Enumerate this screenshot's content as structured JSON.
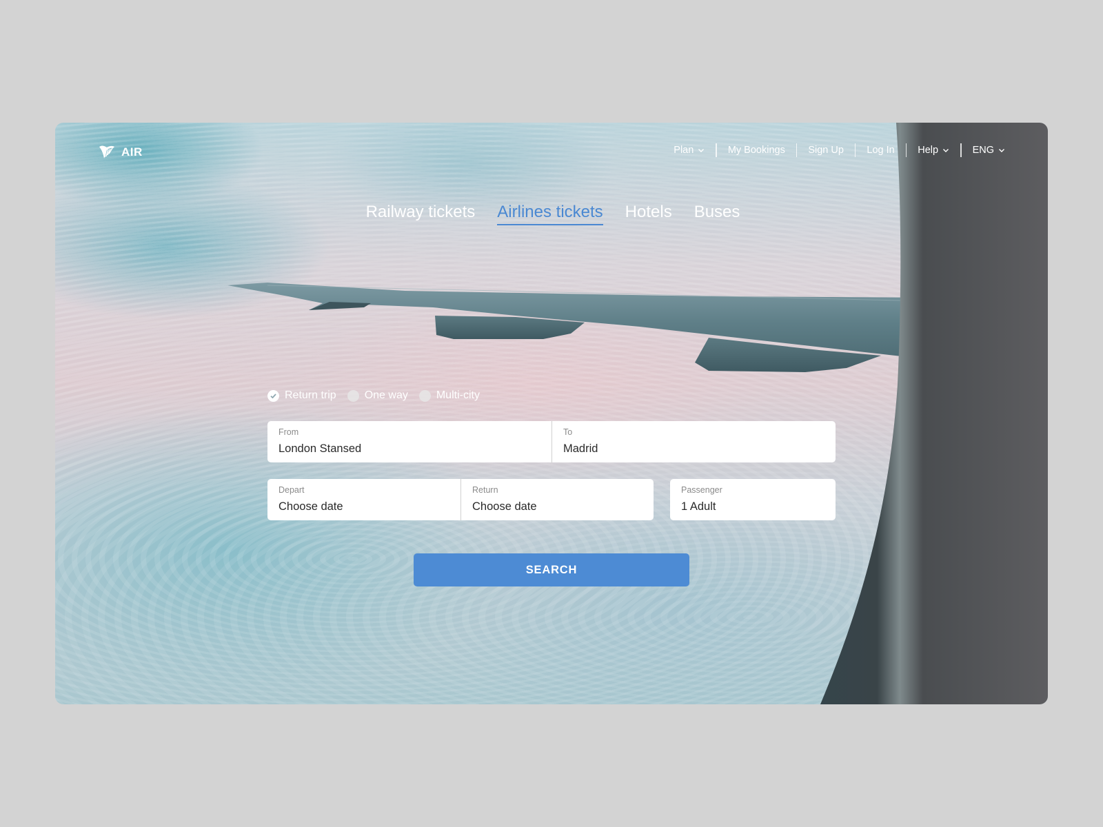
{
  "brand": {
    "name": "AIR",
    "icon": "harp-logo-icon"
  },
  "nav": {
    "items": [
      {
        "label": "Plan",
        "has_dropdown": true
      },
      {
        "label": "My Bookings",
        "has_dropdown": false
      },
      {
        "label": "Sign Up",
        "has_dropdown": false
      },
      {
        "label": "Log In",
        "has_dropdown": false
      },
      {
        "label": "Help",
        "has_dropdown": true
      },
      {
        "label": "ENG",
        "has_dropdown": true
      }
    ]
  },
  "tabs": [
    {
      "label": "Railway tickets",
      "active": false
    },
    {
      "label": "Airlines tickets",
      "active": true
    },
    {
      "label": "Hotels",
      "active": false
    },
    {
      "label": "Buses",
      "active": false
    }
  ],
  "trip_types": [
    {
      "label": "Return trip",
      "selected": true
    },
    {
      "label": "One way",
      "selected": false
    },
    {
      "label": "Multi-city",
      "selected": false
    }
  ],
  "form": {
    "from": {
      "label": "From",
      "value": "London Stansed"
    },
    "to": {
      "label": "To",
      "value": "Madrid"
    },
    "depart": {
      "label": "Depart",
      "value": "Choose date"
    },
    "return": {
      "label": "Return",
      "value": "Choose date"
    },
    "passenger": {
      "label": "Passenger",
      "value": "1 Adult"
    }
  },
  "search_button": {
    "label": "SEARCH"
  },
  "colors": {
    "accent": "#4d8bd4",
    "active_tab": "#4a88d2",
    "page_bg": "#d3d3d3"
  }
}
